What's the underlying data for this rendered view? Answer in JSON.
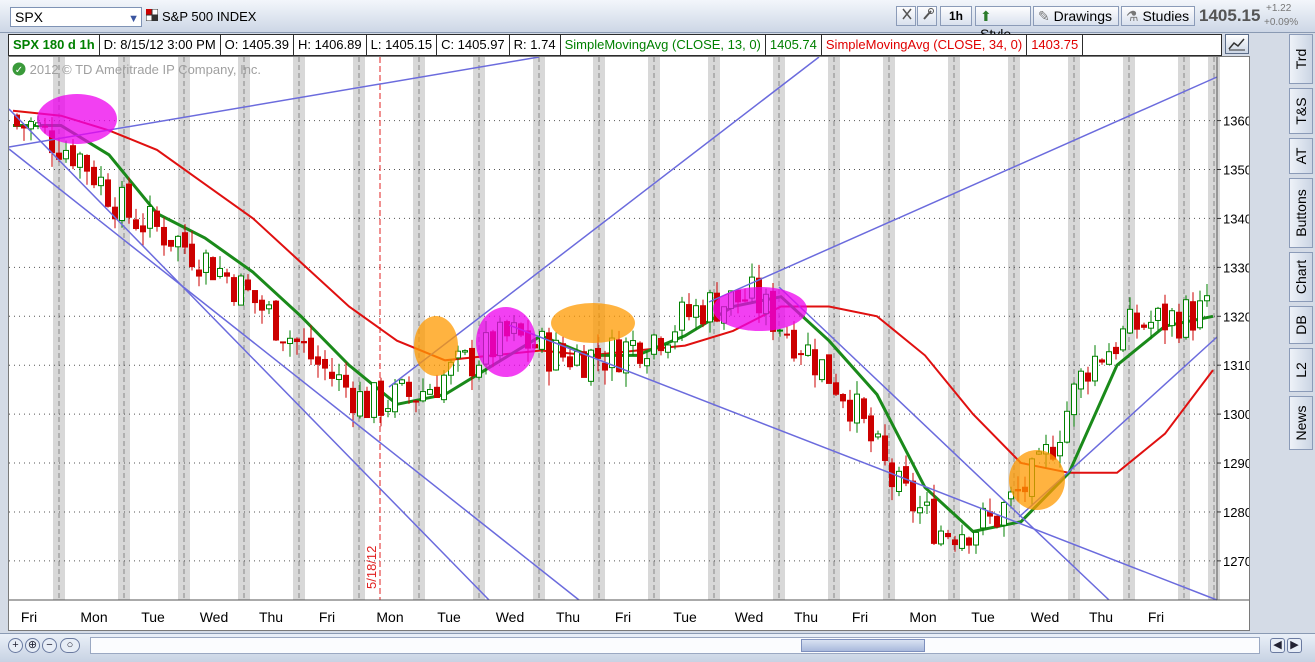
{
  "toolbar": {
    "symbol": "SPX",
    "description": "S&P 500 INDEX",
    "interval_btn": "1h",
    "style_label": "Style",
    "drawings_label": "Drawings",
    "studies_label": "Studies",
    "last_price": "1405.15",
    "net_change": "+1.22",
    "pct_change": "+0.09%"
  },
  "infobar": {
    "symbol_period": "SPX 180 d 1h",
    "date": "D: 8/15/12 3:00 PM",
    "open": "O: 1405.39",
    "high": "H: 1406.89",
    "low": "L: 1405.15",
    "close": "C: 1405.97",
    "range": "R: 1.74",
    "sma13_label": "SimpleMovingAvg (CLOSE, 13, 0)",
    "sma13_value": "1405.74",
    "sma34_label": "SimpleMovingAvg (CLOSE, 34, 0)",
    "sma34_value": "1403.75"
  },
  "copyright": "2012 © TD Ameritrade IP Company, Inc.",
  "side_tabs": [
    "Trd",
    "T&S",
    "AT",
    "Buttons",
    "Chart",
    "DB",
    "L2",
    "News"
  ],
  "colors": {
    "up_candle": "#008000",
    "down_candle": "#cc0000",
    "sma13": "#1a8a1a",
    "sma34": "#e01010",
    "trendline": "#6b6bdd",
    "highlight_magenta": "#ee00ee",
    "highlight_orange": "#ff9900",
    "vline_marker": "#e02020"
  },
  "chart_data": {
    "type": "candlestick",
    "title": "",
    "ylim": [
      1262,
      1373
    ],
    "y_ticks": [
      1270,
      1280,
      1290,
      1300,
      1310,
      1320,
      1330,
      1340,
      1350,
      1360
    ],
    "x_day_labels": [
      "Fri",
      "Mon",
      "Tue",
      "Wed",
      "Thu",
      "Fri",
      "Mon",
      "Tue",
      "Wed",
      "Thu",
      "Fri",
      "Tue",
      "Wed",
      "Thu",
      "Fri",
      "Mon",
      "Tue",
      "Wed",
      "Thu",
      "Fri"
    ],
    "marker_label": "5/18/12",
    "sma13": [
      1359,
      1359,
      1353,
      1341,
      1336,
      1329,
      1320,
      1310,
      1302,
      1304,
      1310,
      1316,
      1312,
      1312,
      1316,
      1322,
      1324,
      1315,
      1304,
      1285,
      1276,
      1278,
      1288,
      1310,
      1318,
      1320
    ],
    "sma34": [
      1362,
      1361,
      1358,
      1354,
      1347,
      1340,
      1331,
      1322,
      1315,
      1311,
      1312,
      1313,
      1312,
      1313,
      1314,
      1317,
      1322,
      1322,
      1320,
      1312,
      1300,
      1290,
      1288,
      1288,
      1296,
      1309
    ],
    "trendlines_note": "",
    "annotations": []
  }
}
